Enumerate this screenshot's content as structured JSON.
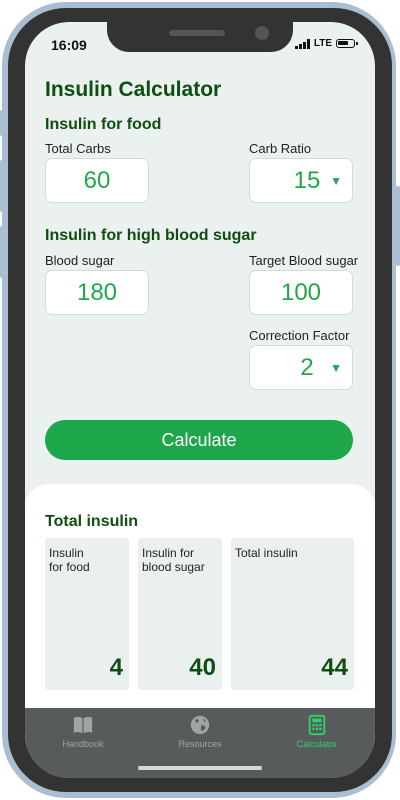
{
  "status_bar": {
    "time": "16:09",
    "network": "LTE"
  },
  "title": "Insulin Calculator",
  "food_section": {
    "heading": "Insulin for food",
    "total_carbs_label": "Total Carbs",
    "total_carbs_value": "60",
    "carb_ratio_label": "Carb Ratio",
    "carb_ratio_value": "15"
  },
  "sugar_section": {
    "heading": "Insulin for high blood sugar",
    "blood_sugar_label": "Blood sugar",
    "blood_sugar_value": "180",
    "target_label": "Target Blood sugar",
    "target_value": "100",
    "correction_label": "Correction Factor",
    "correction_value": "2"
  },
  "calculate_button": "Calculate",
  "results": {
    "heading": "Total insulin",
    "cards": [
      {
        "label": "Insulin\nfor food",
        "value": "4"
      },
      {
        "label": "Insulin for\nblood sugar",
        "value": "40"
      },
      {
        "label": "Total insulin",
        "value": "44"
      }
    ]
  },
  "tabs": [
    {
      "label": "Handbook",
      "icon": "book-icon",
      "active": false
    },
    {
      "label": "Resources",
      "icon": "globe-icon",
      "active": false
    },
    {
      "label": "Calculator",
      "icon": "calculator-icon",
      "active": true
    }
  ],
  "colors": {
    "accent_green": "#1ea64a",
    "value_green": "#20a84a",
    "heading_green": "#0f4d12",
    "active_tab": "#2ed36b",
    "tabbar_bg": "#575b5c",
    "screen_bg": "#ebf1ef"
  }
}
